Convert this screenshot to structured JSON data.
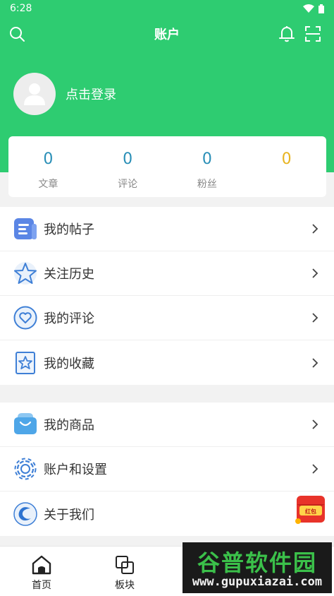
{
  "status_bar": {
    "time": "6:28"
  },
  "header": {
    "title": "账户"
  },
  "profile": {
    "login_text": "点击登录"
  },
  "stats": [
    {
      "value": "0",
      "label": "文章"
    },
    {
      "value": "0",
      "label": "评论"
    },
    {
      "value": "0",
      "label": "粉丝"
    },
    {
      "value": "0",
      "label": ""
    }
  ],
  "menu_group_1": [
    {
      "label": "我的帖子",
      "icon": "posts-icon"
    },
    {
      "label": "关注历史",
      "icon": "star-icon"
    },
    {
      "label": "我的评论",
      "icon": "heart-comment-icon"
    },
    {
      "label": "我的收藏",
      "icon": "bookmark-star-icon"
    }
  ],
  "menu_group_2": [
    {
      "label": "我的商品",
      "icon": "shopping-bag-icon"
    },
    {
      "label": "账户和设置",
      "icon": "gear-icon"
    },
    {
      "label": "关于我们",
      "icon": "about-logo-icon"
    }
  ],
  "bottom_nav": [
    {
      "label": "首页",
      "icon": "home-icon"
    },
    {
      "label": "板块",
      "icon": "section-icon"
    }
  ],
  "float_badge": {
    "text": "红包大派送"
  },
  "watermark": {
    "title": "谷普软件园",
    "url": "www.gupuxiazai.com"
  },
  "colors": {
    "primary_green": "#2ecc71",
    "stat_blue": "#2a8fb7",
    "stat_gold": "#e8b421"
  }
}
